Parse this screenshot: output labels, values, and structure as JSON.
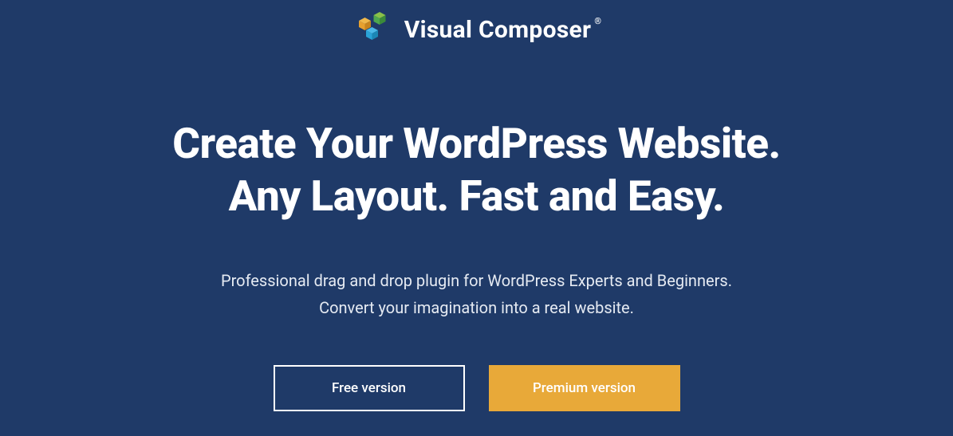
{
  "brand": {
    "name": "Visual Composer",
    "trademark": "®",
    "logo_colors": {
      "block1": "#4fa74e",
      "block2": "#8ac049",
      "block3": "#e7a12f",
      "block4": "#2aa3d8"
    }
  },
  "hero": {
    "headline_line1": "Create Your WordPress Website.",
    "headline_line2": "Any Layout. Fast and Easy.",
    "subtext_line1": "Professional drag and drop plugin for WordPress Experts and Beginners.",
    "subtext_line2": "Convert your imagination into a real website."
  },
  "cta": {
    "free_label": "Free version",
    "premium_label": "Premium version"
  },
  "colors": {
    "background": "#1f3a68",
    "accent": "#e8a939",
    "text": "#ffffff"
  }
}
